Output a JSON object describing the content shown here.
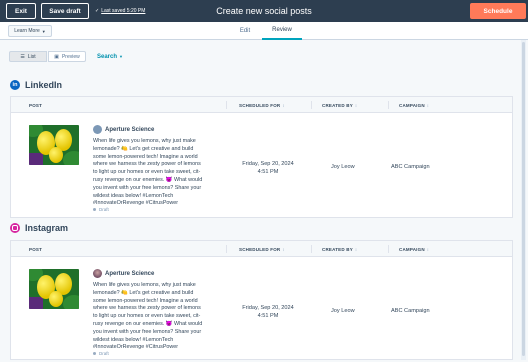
{
  "topbar": {
    "exit_label": "Exit",
    "save_draft_label": "Save draft",
    "last_saved": "Last saved 5:20 PM",
    "title": "Create new social posts",
    "schedule_label": "Schedule"
  },
  "subnav": {
    "learn_more_label": "Learn More",
    "tabs": [
      {
        "label": "Edit"
      },
      {
        "label": "Review",
        "active": true
      }
    ]
  },
  "controls": {
    "list_label": "List",
    "preview_label": "Preview",
    "search_label": "Search"
  },
  "columns": [
    "POST",
    "SCHEDULED FOR",
    "CREATED BY",
    "CAMPAIGN"
  ],
  "sections": [
    {
      "network": "LinkedIn",
      "post": {
        "author": "Aperture Science",
        "text": "When life gives you lemons, why just make\nlemonade? 🍋 Let's get creative and build\nsome lemon-powered tech! Imagine a world\nwhere we harness the zesty power of lemons\nto light up our homes or even take sweet, cit-\nrusy revenge on our enemies. 😈 What would\nyou invent with your free lemons? Share your\nwildest ideas below! #LemonTech\n#InnovateOrRevenge #CitrusPower",
        "status": "Draft",
        "scheduled_for": "Friday, Sep 20, 2024\n4:51 PM",
        "created_by": "Joy Leow",
        "campaign": "ABC Campaign"
      }
    },
    {
      "network": "Instagram",
      "post": {
        "author": "Aperture Science",
        "text": "When life gives you lemons, why just make\nlemonade? 🍋 Let's get creative and build\nsome lemon-powered tech! Imagine a world\nwhere we harness the zesty power of lemons\nto light up our homes or even take sweet, cit-\nrusy revenge on our enemies. 😈 What would\nyou invent with your free lemons? Share your\nwildest ideas below! #LemonTech\n#InnovateOrRevenge #CitrusPower",
        "status": "Draft",
        "scheduled_for": "Friday, Sep 20, 2024\n4:51 PM",
        "created_by": "Joy Leow",
        "campaign": "ABC Campaign"
      }
    }
  ],
  "colors": {
    "topbar_bg": "#2d3e50",
    "accent_orange": "#ff7a59",
    "accent_teal": "#00a4bd",
    "linkedin_blue": "#0a66c2",
    "instagram_pink": "#d6249f"
  }
}
